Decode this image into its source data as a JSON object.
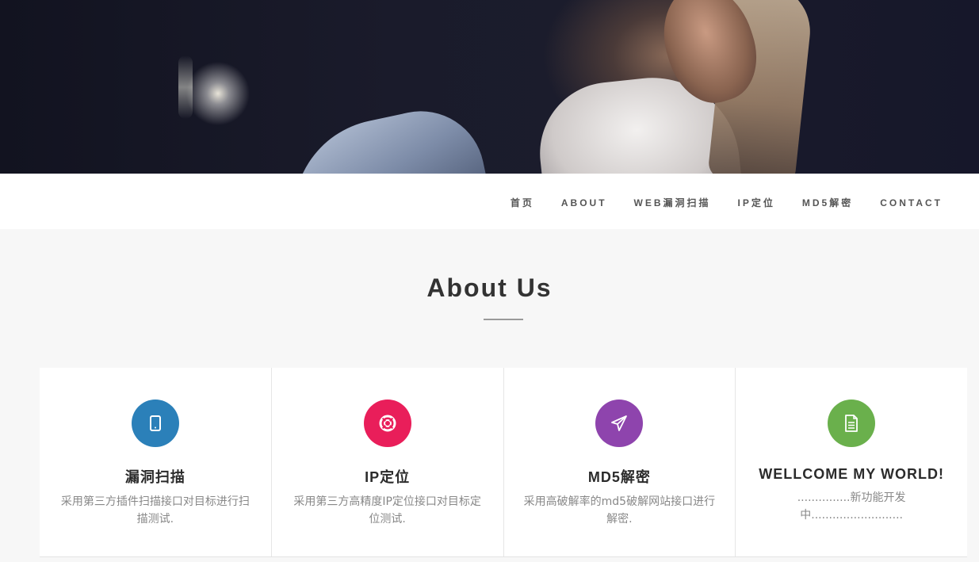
{
  "nav": {
    "items": [
      {
        "label": "首页"
      },
      {
        "label": "ABOUT"
      },
      {
        "label": "WEB漏洞扫描"
      },
      {
        "label": "IP定位"
      },
      {
        "label": "MD5解密"
      },
      {
        "label": "CONTACT"
      }
    ]
  },
  "about": {
    "title": "About Us",
    "cards": [
      {
        "icon": "tablet-icon",
        "color": "#2b80b9",
        "title": "漏洞扫描",
        "text": "采用第三方插件扫描接口对目标进行扫描测试."
      },
      {
        "icon": "life-ring-icon",
        "color": "#e91e5a",
        "title": "IP定位",
        "text": "采用第三方高精度IP定位接口对目标定位测试."
      },
      {
        "icon": "paper-plane-icon",
        "color": "#8e44ad",
        "title": "MD5解密",
        "text": "采用高破解率的md5破解网站接口进行解密."
      },
      {
        "icon": "file-text-icon",
        "color": "#6ab04c",
        "title": "WELLCOME MY WORLD!",
        "text": "...............新功能开发中.........................."
      }
    ]
  }
}
